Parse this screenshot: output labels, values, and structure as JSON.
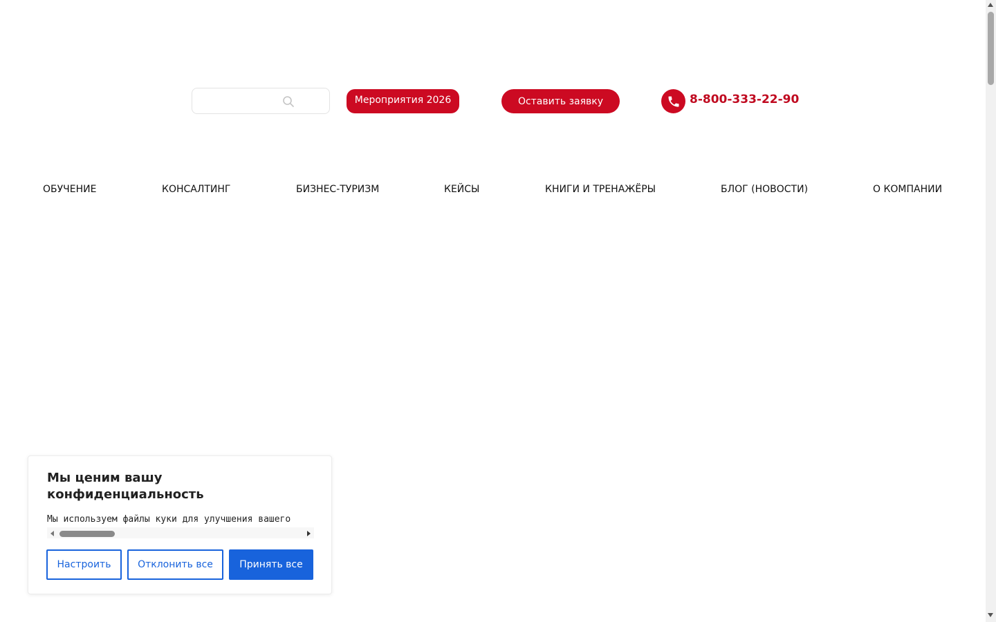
{
  "header": {
    "search": {
      "placeholder": "",
      "value": ""
    },
    "events_button": "Мероприятия 2026",
    "request_button": "Оставить заявку",
    "phone": "8-800-333-22-90"
  },
  "nav": {
    "items": [
      {
        "label": "ОБУЧЕНИЕ"
      },
      {
        "label": "КОНСАЛТИНГ"
      },
      {
        "label": "БИЗНЕС-ТУРИЗМ"
      },
      {
        "label": "КЕЙСЫ"
      },
      {
        "label": "КНИГИ И ТРЕНАЖЁРЫ"
      },
      {
        "label": "БЛОГ (НОВОСТИ)"
      },
      {
        "label": "О КОМПАНИИ"
      }
    ]
  },
  "cookie_banner": {
    "title": "Мы ценим вашу конфиденциальность",
    "text": "Мы используем файлы куки для улучшения вашего",
    "buttons": {
      "customize": "Настроить",
      "reject": "Отклонить все",
      "accept": "Принять все"
    }
  },
  "colors": {
    "brand_red": "#cc0a22",
    "cookie_blue": "#1863dc"
  },
  "icons": {
    "search": "search-icon",
    "phone": "phone-icon"
  }
}
